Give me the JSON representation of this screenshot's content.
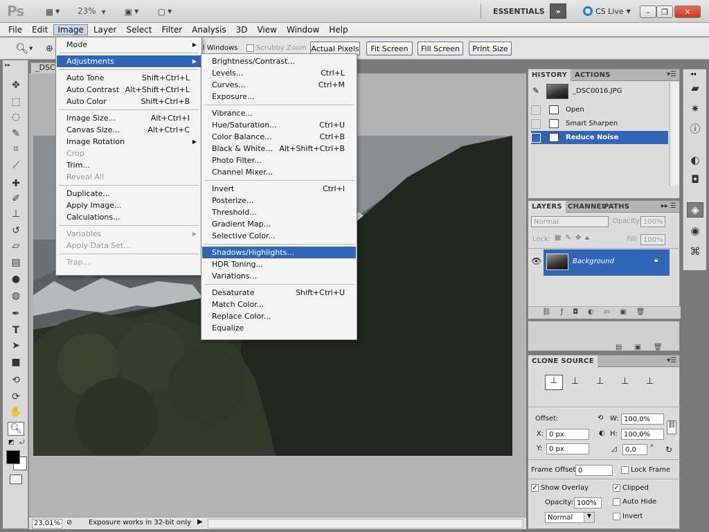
{
  "titlebar": {
    "app": "Ps",
    "zoom": "23%",
    "workspace": "ESSENTIALS",
    "cslive": "CS Live",
    "minimize": "–",
    "restore": "❐",
    "close": "✕"
  },
  "menubar": [
    "File",
    "Edit",
    "Image",
    "Layer",
    "Select",
    "Filter",
    "Analysis",
    "3D",
    "View",
    "Window",
    "Help"
  ],
  "options": {
    "all_windows": "ll Windows",
    "scrubby_zoom": "Scrubby Zoom",
    "actual_pixels": "Actual Pixels",
    "fit_screen": "Fit Screen",
    "fill_screen": "Fill Screen",
    "print_size": "Print Size"
  },
  "document": {
    "tab": "_DSC",
    "zoom": "23,01%",
    "status": "Exposure works in 32-bit only"
  },
  "image_menu": [
    {
      "label": "Mode",
      "shortcut": "",
      "submenu": true
    },
    {
      "sep": true
    },
    {
      "label": "Adjustments",
      "shortcut": "",
      "submenu": true,
      "highlight": true
    },
    {
      "sep": true
    },
    {
      "label": "Auto Tone",
      "shortcut": "Shift+Ctrl+L"
    },
    {
      "label": "Auto Contrast",
      "shortcut": "Alt+Shift+Ctrl+L"
    },
    {
      "label": "Auto Color",
      "shortcut": "Shift+Ctrl+B"
    },
    {
      "sep": true
    },
    {
      "label": "Image Size...",
      "shortcut": "Alt+Ctrl+I"
    },
    {
      "label": "Canvas Size...",
      "shortcut": "Alt+Ctrl+C"
    },
    {
      "label": "Image Rotation",
      "shortcut": "",
      "submenu": true
    },
    {
      "label": "Crop",
      "shortcut": "",
      "disabled": true
    },
    {
      "label": "Trim...",
      "shortcut": ""
    },
    {
      "label": "Reveal All",
      "shortcut": "",
      "disabled": true
    },
    {
      "sep": true
    },
    {
      "label": "Duplicate...",
      "shortcut": ""
    },
    {
      "label": "Apply Image...",
      "shortcut": ""
    },
    {
      "label": "Calculations...",
      "shortcut": ""
    },
    {
      "sep": true
    },
    {
      "label": "Variables",
      "shortcut": "",
      "submenu": true,
      "disabled": true
    },
    {
      "label": "Apply Data Set...",
      "shortcut": "",
      "disabled": true
    },
    {
      "sep": true
    },
    {
      "label": "Trap...",
      "shortcut": "",
      "disabled": true
    }
  ],
  "adjust_menu": [
    {
      "label": "Brightness/Contrast...",
      "shortcut": ""
    },
    {
      "label": "Levels...",
      "shortcut": "Ctrl+L"
    },
    {
      "label": "Curves...",
      "shortcut": "Ctrl+M"
    },
    {
      "label": "Exposure...",
      "shortcut": ""
    },
    {
      "sep": true
    },
    {
      "label": "Vibrance...",
      "shortcut": ""
    },
    {
      "label": "Hue/Saturation...",
      "shortcut": "Ctrl+U"
    },
    {
      "label": "Color Balance...",
      "shortcut": "Ctrl+B"
    },
    {
      "label": "Black & White...",
      "shortcut": "Alt+Shift+Ctrl+B"
    },
    {
      "label": "Photo Filter...",
      "shortcut": ""
    },
    {
      "label": "Channel Mixer...",
      "shortcut": ""
    },
    {
      "sep": true
    },
    {
      "label": "Invert",
      "shortcut": "Ctrl+I"
    },
    {
      "label": "Posterize...",
      "shortcut": ""
    },
    {
      "label": "Threshold...",
      "shortcut": ""
    },
    {
      "label": "Gradient Map...",
      "shortcut": ""
    },
    {
      "label": "Selective Color...",
      "shortcut": ""
    },
    {
      "sep": true
    },
    {
      "label": "Shadows/Highlights...",
      "shortcut": "",
      "highlight": true
    },
    {
      "label": "HDR Toning...",
      "shortcut": ""
    },
    {
      "label": "Variations...",
      "shortcut": ""
    },
    {
      "sep": true
    },
    {
      "label": "Desaturate",
      "shortcut": "Shift+Ctrl+U"
    },
    {
      "label": "Match Color...",
      "shortcut": ""
    },
    {
      "label": "Replace Color...",
      "shortcut": ""
    },
    {
      "label": "Equalize",
      "shortcut": ""
    }
  ],
  "history": {
    "tabs": [
      "HISTORY",
      "ACTIONS"
    ],
    "snapshot": "_DSC0016.JPG",
    "steps": [
      {
        "label": "Open"
      },
      {
        "label": "Smart Sharpen"
      },
      {
        "label": "Reduce Noise",
        "selected": true
      }
    ]
  },
  "layers": {
    "tabs": [
      "LAYERS",
      "CHANNEL",
      "PATHS"
    ],
    "blend": "Normal",
    "opacity_label": "Opacity:",
    "opacity": "100%",
    "lock_label": "Lock:",
    "fill_label": "Fill:",
    "fill": "100%",
    "layer_name": "Background"
  },
  "clone": {
    "title": "CLONE SOURCE",
    "offset_label": "Offset:",
    "x_label": "X:",
    "x": "0 px",
    "y_label": "Y:",
    "y": "0 px",
    "w_label": "W:",
    "w": "100,0%",
    "h_label": "H:",
    "h": "100,0%",
    "angle": "0,0",
    "deg": "°",
    "frame_offset_label": "Frame Offset:",
    "frame_offset": "0",
    "lock_frame": "Lock Frame",
    "show_overlay": "Show Overlay",
    "clipped": "Clipped",
    "opacity_label": "Opacity:",
    "opacity": "100%",
    "auto_hide": "Auto Hide",
    "mode": "Normal",
    "invert": "Invert"
  }
}
